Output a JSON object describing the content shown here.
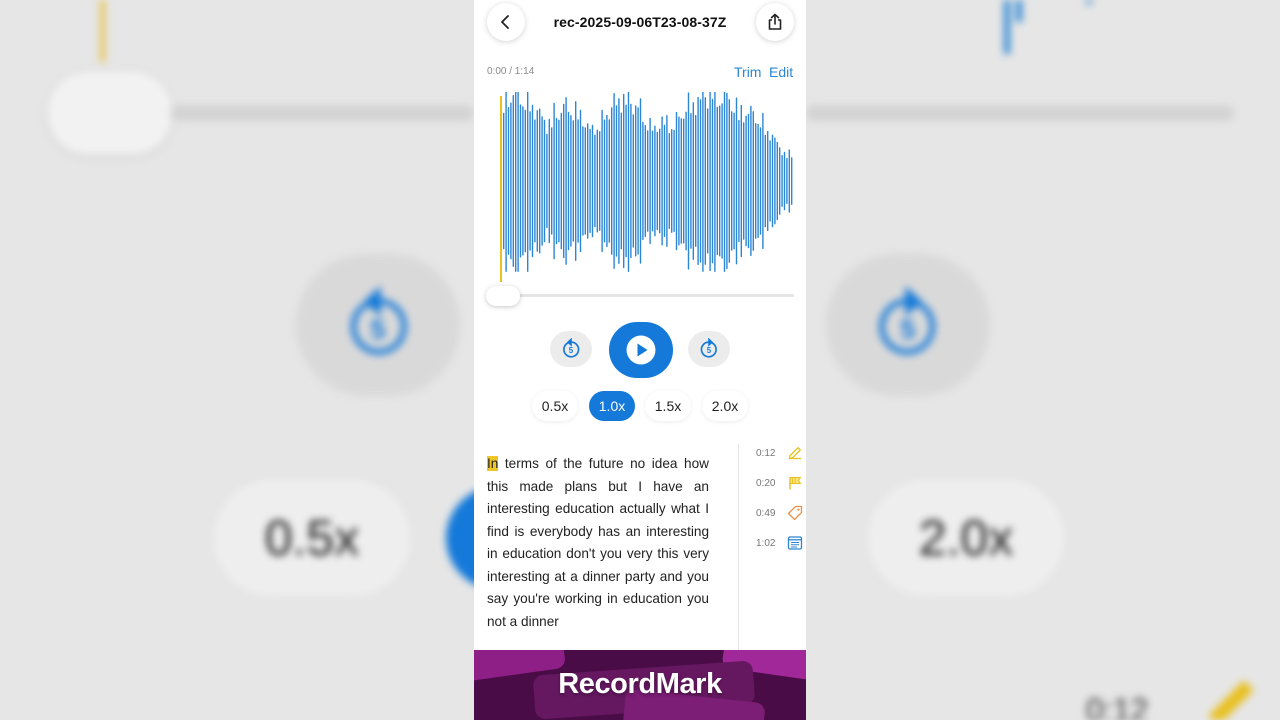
{
  "header": {
    "title": "rec-2025-09-06T23-08-37Z",
    "back_icon": "chevron-left-icon",
    "share_icon": "share-icon"
  },
  "player": {
    "time": "0:00 / 1:14",
    "trim_label": "Trim",
    "edit_label": "Edit",
    "skip_seconds": "5",
    "progress": 0.0
  },
  "speeds": [
    {
      "label": "0.5x",
      "active": false
    },
    {
      "label": "1.0x",
      "active": true
    },
    {
      "label": "1.5x",
      "active": false
    },
    {
      "label": "2.0x",
      "active": false
    }
  ],
  "transcript": {
    "highlighted_word": "In",
    "text": " terms of the future no idea how this made plans but I have an interesting education actually what I find is everybody has an interesting in education don't you very this very interesting at a dinner party and you say you're working in education you not a dinner"
  },
  "markers": [
    {
      "time": "0:12",
      "icon": "pencil-icon",
      "color": "#e8c020"
    },
    {
      "time": "0:20",
      "icon": "flag-icon",
      "color": "#e8c020"
    },
    {
      "time": "0:49",
      "icon": "tag-icon",
      "color": "#e8924a"
    },
    {
      "time": "1:02",
      "icon": "list-icon",
      "color": "#2c86d4"
    }
  ],
  "banner": {
    "text": "RecordMark"
  },
  "background": {
    "speed_left": "0.5x",
    "speed_right": "2.0x",
    "marker_time": "0:12",
    "skip_seconds": "5"
  },
  "colors": {
    "accent": "#1479d9",
    "waveform": "#2c86d4",
    "playhead": "#e8c020",
    "highlight": "#f0c528",
    "banner": "#4a0c46"
  }
}
